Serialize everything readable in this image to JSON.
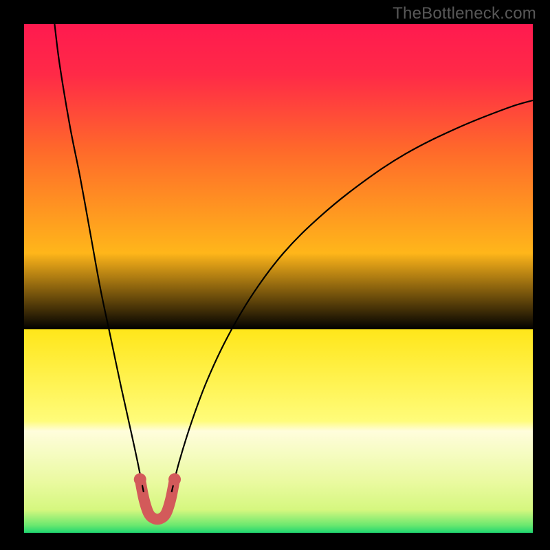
{
  "watermark": "TheBottleneck.com",
  "chart_data": {
    "type": "line",
    "title": "",
    "xlabel": "",
    "ylabel": "",
    "xlim": [
      0,
      100
    ],
    "ylim": [
      0,
      100
    ],
    "gradient_stops": [
      {
        "offset": 0.0,
        "color": "#ff1a4f"
      },
      {
        "offset": 0.1,
        "color": "#ff2a47"
      },
      {
        "offset": 0.25,
        "color": "#ff6a2a"
      },
      {
        "offset": 0.45,
        "color": "#ffb61a"
      },
      {
        "offset": 0.6,
        "color": "#ffeździane"
      },
      {
        "offset": 0.6,
        "color": "#ffe61a"
      },
      {
        "offset": 0.78,
        "color": "#fffc7a"
      },
      {
        "offset": 0.8,
        "color": "#fffddc"
      },
      {
        "offset": 0.9,
        "color": "#eafaa0"
      },
      {
        "offset": 0.955,
        "color": "#d5f77f"
      },
      {
        "offset": 0.985,
        "color": "#6be86f"
      },
      {
        "offset": 1.0,
        "color": "#1fd670"
      }
    ],
    "series": [
      {
        "name": "left-curve",
        "style": {
          "stroke": "#000000",
          "width": 2.2,
          "fill": "none"
        },
        "points": [
          {
            "x": 6.0,
            "y": 100.0
          },
          {
            "x": 7.0,
            "y": 92.0
          },
          {
            "x": 9.0,
            "y": 80.0
          },
          {
            "x": 11.0,
            "y": 70.0
          },
          {
            "x": 13.0,
            "y": 59.0
          },
          {
            "x": 15.0,
            "y": 48.0
          },
          {
            "x": 17.0,
            "y": 38.5
          },
          {
            "x": 19.0,
            "y": 29.0
          },
          {
            "x": 21.0,
            "y": 20.0
          },
          {
            "x": 22.3,
            "y": 14.0
          },
          {
            "x": 23.5,
            "y": 8.0
          }
        ]
      },
      {
        "name": "right-curve",
        "style": {
          "stroke": "#000000",
          "width": 2.2,
          "fill": "none"
        },
        "points": [
          {
            "x": 29.0,
            "y": 8.0
          },
          {
            "x": 30.5,
            "y": 14.0
          },
          {
            "x": 33.0,
            "y": 22.0
          },
          {
            "x": 36.0,
            "y": 30.0
          },
          {
            "x": 40.0,
            "y": 38.5
          },
          {
            "x": 45.0,
            "y": 47.0
          },
          {
            "x": 51.0,
            "y": 55.0
          },
          {
            "x": 58.0,
            "y": 62.0
          },
          {
            "x": 66.0,
            "y": 68.5
          },
          {
            "x": 75.0,
            "y": 74.5
          },
          {
            "x": 85.0,
            "y": 79.5
          },
          {
            "x": 95.0,
            "y": 83.5
          },
          {
            "x": 100.0,
            "y": 85.0
          }
        ]
      },
      {
        "name": "bottom-u-highlight",
        "style": {
          "stroke": "#d35a5a",
          "width": 16,
          "fill": "none",
          "linecap": "round",
          "linejoin": "round"
        },
        "points": [
          {
            "x": 22.8,
            "y": 10.5
          },
          {
            "x": 23.6,
            "y": 6.5
          },
          {
            "x": 24.5,
            "y": 3.8
          },
          {
            "x": 25.6,
            "y": 2.8
          },
          {
            "x": 26.8,
            "y": 2.8
          },
          {
            "x": 27.9,
            "y": 3.8
          },
          {
            "x": 28.8,
            "y": 6.5
          },
          {
            "x": 29.6,
            "y": 10.5
          }
        ]
      },
      {
        "name": "u-left-dot",
        "style": {
          "marker": "circle",
          "fill": "#d35a5a",
          "r": 9
        },
        "points": [
          {
            "x": 22.8,
            "y": 10.5
          }
        ]
      },
      {
        "name": "u-right-dot",
        "style": {
          "marker": "circle",
          "fill": "#d35a5a",
          "r": 9
        },
        "points": [
          {
            "x": 29.6,
            "y": 10.5
          }
        ]
      }
    ]
  }
}
